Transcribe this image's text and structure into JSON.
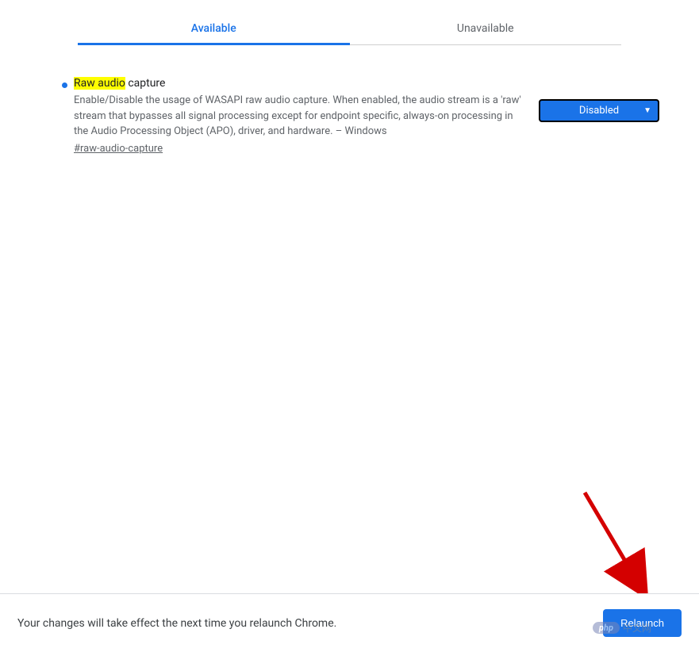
{
  "tabs": {
    "available": "Available",
    "unavailable": "Unavailable"
  },
  "flag": {
    "title_highlight": "Raw audio",
    "title_rest": " capture",
    "description": "Enable/Disable the usage of WASAPI raw audio capture. When enabled, the audio stream is a 'raw' stream that bypasses all signal processing except for endpoint specific, always-on processing in the Audio Processing Object (APO), driver, and hardware. – Windows",
    "anchor": "#raw-audio-capture",
    "dropdown_value": "Disabled"
  },
  "footer": {
    "message": "Your changes will take effect the next time you relaunch Chrome.",
    "button": "Relaunch"
  },
  "watermark": {
    "badge": "php",
    "text": "中文网"
  }
}
